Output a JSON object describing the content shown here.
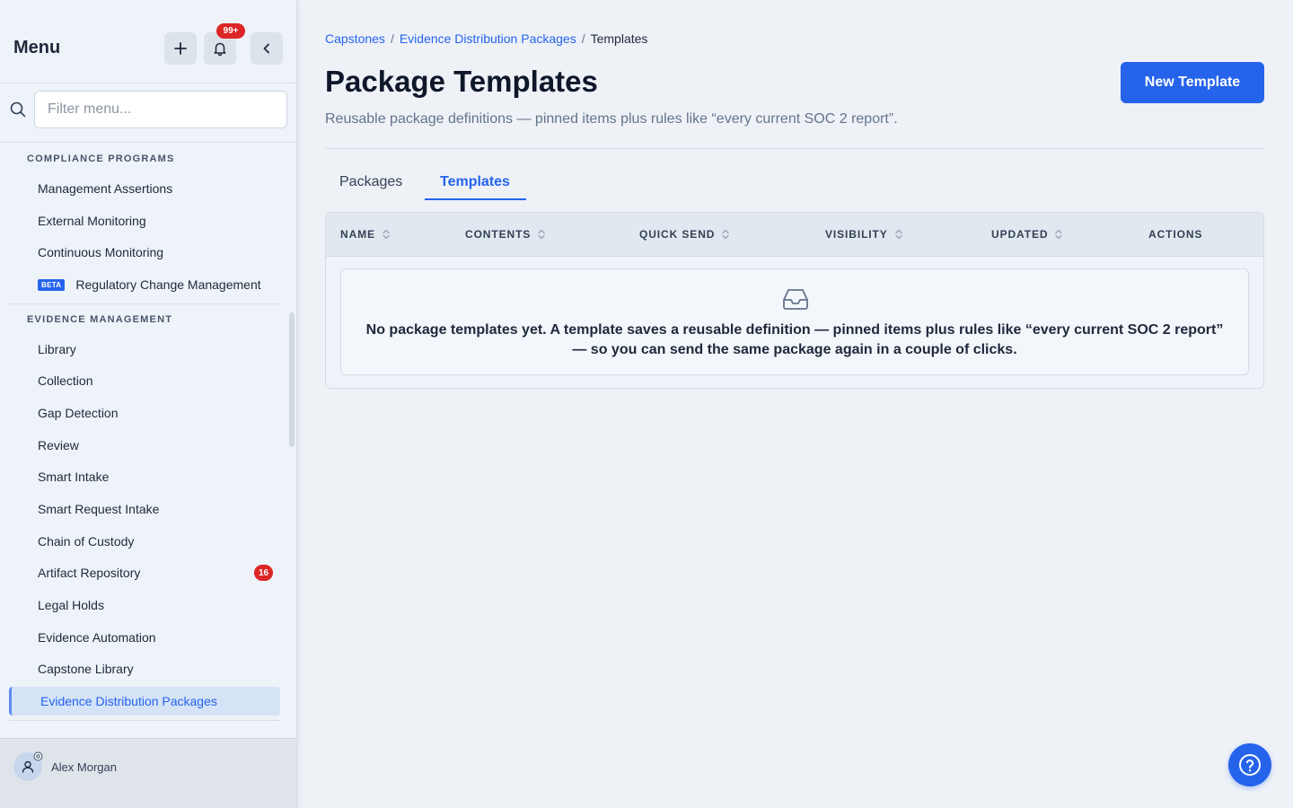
{
  "sidebar": {
    "title": "Menu",
    "notifications_badge": "99+",
    "filter_placeholder": "Filter menu...",
    "sections": [
      {
        "heading": "COMPLIANCE PROGRAMS",
        "items": [
          {
            "label": "Management Assertions"
          },
          {
            "label": "External Monitoring"
          },
          {
            "label": "Continuous Monitoring"
          },
          {
            "label": "Regulatory Change Management",
            "tag": "BETA"
          }
        ]
      },
      {
        "heading": "EVIDENCE MANAGEMENT",
        "items": [
          {
            "label": "Library"
          },
          {
            "label": "Collection"
          },
          {
            "label": "Gap Detection"
          },
          {
            "label": "Review"
          },
          {
            "label": "Smart Intake"
          },
          {
            "label": "Smart Request Intake"
          },
          {
            "label": "Chain of Custody"
          },
          {
            "label": "Artifact Repository",
            "count": "16"
          },
          {
            "label": "Legal Holds"
          },
          {
            "label": "Evidence Automation"
          },
          {
            "label": "Capstone Library"
          },
          {
            "label": "Evidence Distribution Packages",
            "active": true
          }
        ]
      }
    ],
    "user": {
      "name": "Alex Morgan"
    }
  },
  "breadcrumb": {
    "items": [
      "Capstones",
      "Evidence Distribution Packages",
      "Templates"
    ],
    "separator": "/"
  },
  "header": {
    "title": "Package Templates",
    "subtitle": "Reusable package definitions — pinned items plus rules like “every current SOC 2 report”.",
    "primary_button": "New Template"
  },
  "tabs": [
    {
      "label": "Packages",
      "active": false
    },
    {
      "label": "Templates",
      "active": true
    }
  ],
  "table": {
    "columns": [
      "NAME",
      "CONTENTS",
      "QUICK SEND",
      "VISIBILITY",
      "UPDATED",
      "ACTIONS"
    ],
    "empty_message": "No package templates yet. A template saves a reusable definition — pinned items plus rules like “every current SOC 2 report” — so you can send the same package again in a couple of clicks."
  },
  "colors": {
    "accent": "#2563eb",
    "badge": "#dc2626",
    "background": "#eef2f7"
  },
  "icons": [
    "plus-icon",
    "bell-icon",
    "chevron-left-icon",
    "search-icon",
    "user-icon",
    "gear-icon",
    "sort-icon",
    "inbox-icon",
    "help-icon"
  ]
}
